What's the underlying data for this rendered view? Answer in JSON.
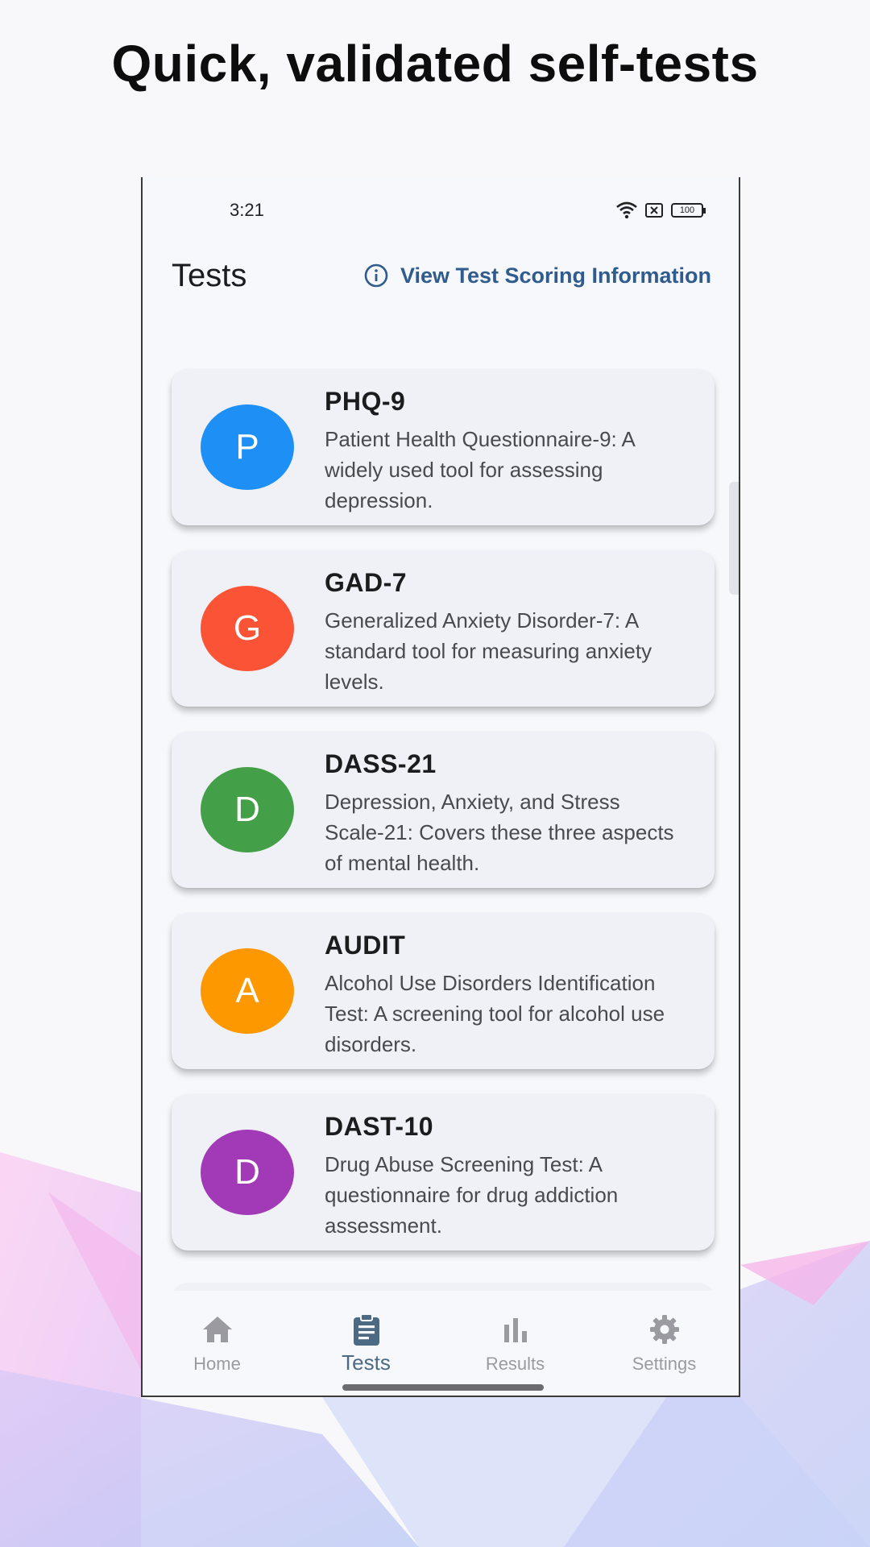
{
  "headline": "Quick, validated self-tests",
  "status_bar": {
    "time": "3:21",
    "battery": "100",
    "icons": [
      "wifi-icon",
      "sim-x-icon",
      "battery-icon"
    ]
  },
  "header": {
    "title": "Tests",
    "info_link": "View Test Scoring Information",
    "info_icon": "info-circle-icon",
    "accent_color": "#2f5c8c"
  },
  "tests": [
    {
      "letter": "P",
      "name": "PHQ-9",
      "description": "Patient Health Questionnaire-9: A widely used tool for assessing depression.",
      "color": "#1e90f5"
    },
    {
      "letter": "G",
      "name": "GAD-7",
      "description": "Generalized Anxiety Disorder-7: A standard tool for measuring anxiety levels.",
      "color": "#fb5335"
    },
    {
      "letter": "D",
      "name": "DASS-21",
      "description": "Depression, Anxiety, and Stress Scale-21: Covers these three aspects of mental health.",
      "color": "#43a048"
    },
    {
      "letter": "A",
      "name": "AUDIT",
      "description": "Alcohol Use Disorders Identification Test: A screening tool for alcohol use disorders.",
      "color": "#fe9800"
    },
    {
      "letter": "D",
      "name": "DAST-10",
      "description": "Drug Abuse Screening Test: A questionnaire for drug addiction assessment.",
      "color": "#a23ab8"
    }
  ],
  "bottom_nav": {
    "items": [
      {
        "label": "Home",
        "icon": "home-icon",
        "active": false
      },
      {
        "label": "Tests",
        "icon": "clipboard-icon",
        "active": true
      },
      {
        "label": "Results",
        "icon": "bar-chart-icon",
        "active": false
      },
      {
        "label": "Settings",
        "icon": "gear-icon",
        "active": false
      }
    ],
    "active_color": "#4d6a84",
    "inactive_color": "#9a9aa0"
  }
}
